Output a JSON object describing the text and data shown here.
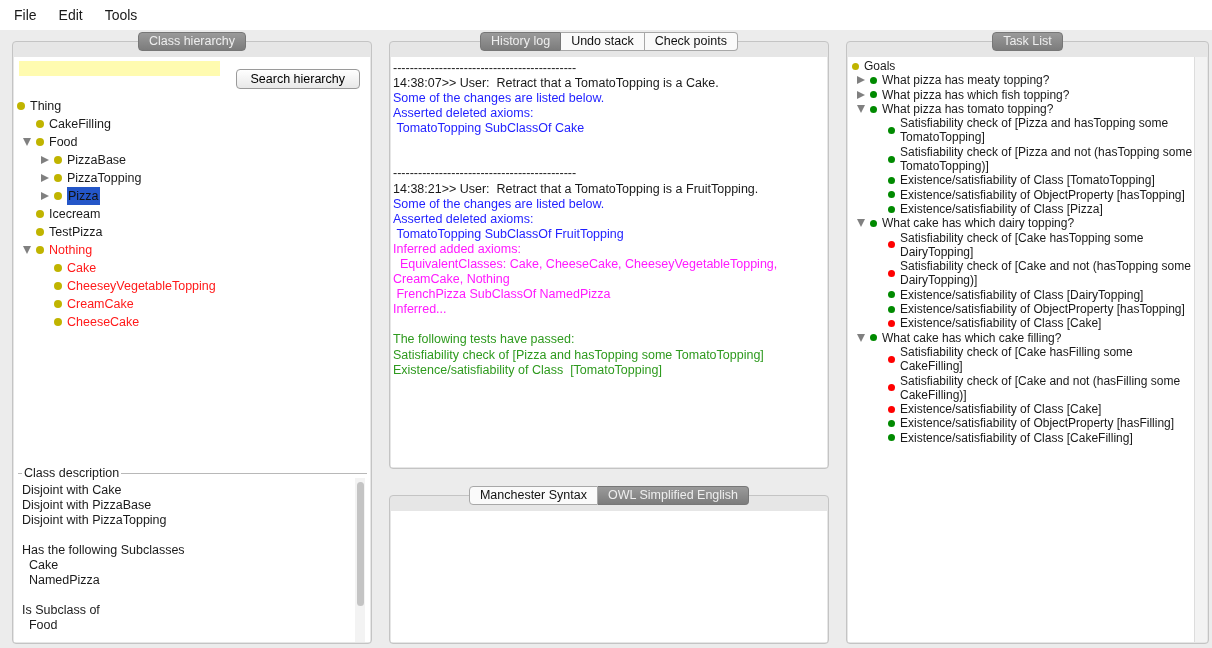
{
  "menu": [
    "File",
    "Edit",
    "Tools"
  ],
  "class_hierarchy": {
    "title": "Class hierarchy",
    "search_button": "Search hierarchy",
    "tree": [
      {
        "label": "Thing",
        "selected": false,
        "unsatisfiable": false,
        "children": [
          {
            "label": "CakeFilling",
            "selected": false,
            "unsatisfiable": false
          },
          {
            "label": "Food",
            "expanded": true,
            "selected": false,
            "unsatisfiable": false,
            "children": [
              {
                "label": "PizzaBase",
                "expanded": false,
                "selected": false,
                "unsatisfiable": false
              },
              {
                "label": "PizzaTopping",
                "expanded": false,
                "selected": false,
                "unsatisfiable": false
              },
              {
                "label": "Pizza",
                "expanded": false,
                "selected": true,
                "unsatisfiable": false
              }
            ]
          },
          {
            "label": "Icecream",
            "selected": false,
            "unsatisfiable": false
          },
          {
            "label": "TestPizza",
            "selected": false,
            "unsatisfiable": false
          },
          {
            "label": "Nothing",
            "expanded": true,
            "selected": false,
            "unsatisfiable": true,
            "children": [
              {
                "label": "Cake",
                "selected": false,
                "unsatisfiable": true
              },
              {
                "label": "CheeseyVegetableTopping",
                "selected": false,
                "unsatisfiable": true
              },
              {
                "label": "CreamCake",
                "selected": false,
                "unsatisfiable": true
              },
              {
                "label": "CheeseCake",
                "selected": false,
                "unsatisfiable": true
              }
            ]
          }
        ]
      }
    ]
  },
  "class_description": {
    "title": "Class description",
    "paragraphs": [
      [
        "Disjoint with Cake",
        "Disjoint with PizzaBase",
        "Disjoint with PizzaTopping"
      ],
      [
        "Has the following Subclasses",
        "  Cake",
        "  NamedPizza"
      ],
      [
        "Is Subclass of",
        "  Food"
      ]
    ]
  },
  "history": {
    "tabs": [
      {
        "label": "History log",
        "selected": true
      },
      {
        "label": "Undo stack",
        "selected": false
      },
      {
        "label": "Check points",
        "selected": false
      }
    ],
    "blocks": [
      [
        {
          "kind": "separator",
          "text": "--------------------------------------------"
        },
        {
          "kind": "user",
          "text": "14:38:07>> User:  Retract that a TomatoTopping is a Cake."
        },
        {
          "kind": "change",
          "text": "Some of the changes are listed below."
        },
        {
          "kind": "change",
          "text": "Asserted deleted axioms:"
        },
        {
          "kind": "change",
          "text": " TomatoTopping SubClassOf Cake"
        }
      ],
      [
        {
          "kind": "separator",
          "text": "--------------------------------------------"
        },
        {
          "kind": "user",
          "text": "14:38:21>> User:  Retract that a TomatoTopping is a FruitTopping."
        },
        {
          "kind": "change",
          "text": "Some of the changes are listed below."
        },
        {
          "kind": "change",
          "text": "Asserted deleted axioms:"
        },
        {
          "kind": "change",
          "text": " TomatoTopping SubClassOf FruitTopping"
        },
        {
          "kind": "inferred",
          "text": "Inferred added axioms:"
        },
        {
          "kind": "inferred",
          "text": "  EquivalentClasses: Cake, CheeseCake, CheeseyVegetableTopping, CreamCake, Nothing"
        },
        {
          "kind": "inferred",
          "text": " FrenchPizza SubClassOf NamedPizza"
        },
        {
          "kind": "inferred",
          "text": "Inferred..."
        }
      ],
      [
        {
          "kind": "passed",
          "text": "The following tests have passed:"
        },
        {
          "kind": "passed",
          "text": "Satisfiability check of [Pizza and hasTopping some TomatoTopping]"
        },
        {
          "kind": "passed",
          "text": "Existence/satisfiability of Class  [TomatoTopping]"
        }
      ]
    ]
  },
  "syntax": {
    "tabs": [
      {
        "label": "Manchester Syntax",
        "selected": false
      },
      {
        "label": "OWL Simplified English",
        "selected": true
      }
    ]
  },
  "task_list": {
    "title": "Task List",
    "tree": [
      {
        "label": "Goals",
        "color": "#c0b400",
        "children": [
          {
            "label": "What pizza has meaty topping?",
            "expanded": false,
            "color": "#008a00"
          },
          {
            "label": "What pizza has which fish topping?",
            "expanded": false,
            "color": "#008a00"
          },
          {
            "label": "What pizza has tomato topping?",
            "expanded": true,
            "color": "#008a00",
            "children": [
              {
                "label": "Satisfiability check of [Pizza and hasTopping some TomatoTopping]",
                "color": "#008a00"
              },
              {
                "label": "Satisfiability check of [Pizza and not (hasTopping some TomatoTopping)]",
                "color": "#008a00"
              },
              {
                "label": "Existence/satisfiability of Class [TomatoTopping]",
                "color": "#008a00"
              },
              {
                "label": "Existence/satisfiability of ObjectProperty [hasTopping]",
                "color": "#008a00"
              },
              {
                "label": "Existence/satisfiability of Class [Pizza]",
                "color": "#008a00"
              }
            ]
          },
          {
            "label": "What cake has which dairy topping?",
            "expanded": true,
            "color": "#008a00",
            "children": [
              {
                "label": "Satisfiability check of [Cake hasTopping some DairyTopping]",
                "color": "#ff0000"
              },
              {
                "label": "Satisfiability check of [Cake and not (hasTopping some DairyTopping)]",
                "color": "#ff0000"
              },
              {
                "label": "Existence/satisfiability of Class [DairyTopping]",
                "color": "#008a00"
              },
              {
                "label": "Existence/satisfiability of ObjectProperty [hasTopping]",
                "color": "#008a00"
              },
              {
                "label": "Existence/satisfiability of Class [Cake]",
                "color": "#ff0000"
              }
            ]
          },
          {
            "label": "What cake has which cake filling?",
            "expanded": true,
            "color": "#008a00",
            "children": [
              {
                "label": "Satisfiability check of [Cake hasFilling some CakeFilling]",
                "color": "#ff0000"
              },
              {
                "label": "Satisfiability check of [Cake and not (hasFilling some CakeFilling)]",
                "color": "#ff0000"
              },
              {
                "label": "Existence/satisfiability of Class [Cake]",
                "color": "#ff0000"
              },
              {
                "label": "Existence/satisfiability of ObjectProperty [hasFilling]",
                "color": "#008a00"
              },
              {
                "label": "Existence/satisfiability of Class [CakeFilling]",
                "color": "#008a00"
              }
            ]
          }
        ]
      }
    ]
  }
}
